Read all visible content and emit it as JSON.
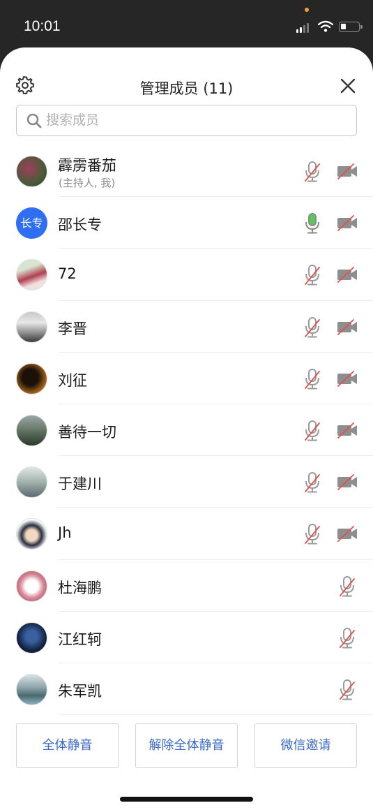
{
  "status_bar": {
    "time": "10:01"
  },
  "header": {
    "title": "管理成员 (11)"
  },
  "search": {
    "placeholder": "搜索成员"
  },
  "members": [
    {
      "name": "霹雳番茄",
      "sub": "(主持人, 我)",
      "mic": "muted",
      "camera": "off"
    },
    {
      "name": "邵长专",
      "avatar_text": "长专",
      "mic": "on",
      "camera": "off"
    },
    {
      "name": "72",
      "mic": "muted",
      "camera": "off"
    },
    {
      "name": "李晋",
      "mic": "muted",
      "camera": "off"
    },
    {
      "name": "刘征",
      "mic": "muted",
      "camera": "off"
    },
    {
      "name": "善待一切",
      "mic": "muted",
      "camera": "off"
    },
    {
      "name": "于建川",
      "mic": "muted",
      "camera": "off"
    },
    {
      "name": "Jh",
      "mic": "muted",
      "camera": "off"
    },
    {
      "name": "杜海鹏",
      "mic": "muted",
      "camera": "none"
    },
    {
      "name": "江红轲",
      "mic": "muted",
      "camera": "none"
    },
    {
      "name": "朱军凯",
      "mic": "muted",
      "camera": "none"
    }
  ],
  "actions": {
    "mute_all": "全体静音",
    "unmute_all": "解除全体静音",
    "wechat_invite": "微信邀请"
  },
  "colors": {
    "accent": "#3c6bc6",
    "mic_on": "#5cc85c",
    "muted_slash": "#e05050",
    "avatar_blue": "#2d6ff0"
  }
}
